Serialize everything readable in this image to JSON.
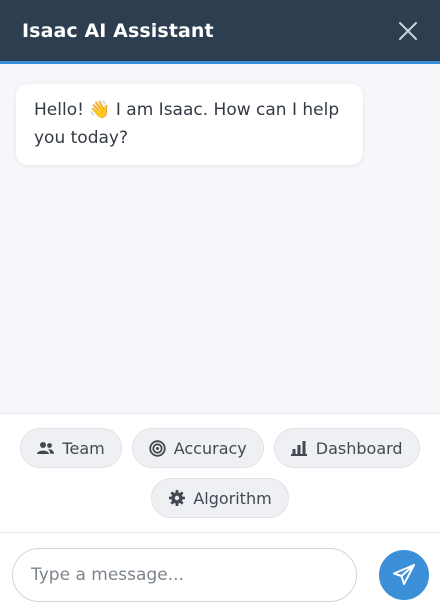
{
  "header": {
    "title": "Isaac AI Assistant",
    "close_icon": "close-icon"
  },
  "messages": [
    {
      "sender": "bot",
      "text_before": "Hello! ",
      "emoji": "👋",
      "text_after": " I am Isaac. How can I help you today?"
    }
  ],
  "quick_replies": [
    {
      "label": "Team",
      "icon": "users-icon"
    },
    {
      "label": "Accuracy",
      "icon": "target-icon"
    },
    {
      "label": "Dashboard",
      "icon": "bar-chart-icon"
    },
    {
      "label": "Algorithm",
      "icon": "gear-icon"
    }
  ],
  "composer": {
    "placeholder": "Type a message...",
    "value": "",
    "send_icon": "send-icon"
  },
  "colors": {
    "header_bg": "#2c3e50",
    "accent": "#3a8fd6",
    "messages_bg": "#f5f7fa"
  }
}
